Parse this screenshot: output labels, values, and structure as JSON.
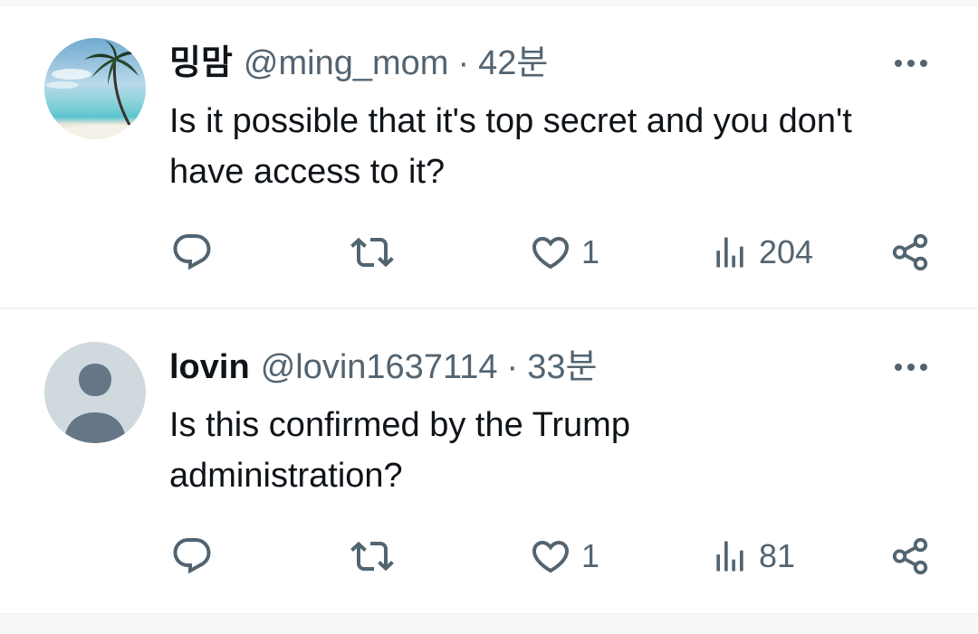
{
  "tweets": [
    {
      "display_name": "밍맘",
      "handle": "@ming_mom",
      "separator": "·",
      "time": "42분",
      "text": "Is it possible that it's top secret and you don't have access to it?",
      "avatar_icon": "palm-beach-avatar",
      "likes": "1",
      "views": "204"
    },
    {
      "display_name": "lovin",
      "handle": "@lovin1637114",
      "separator": "·",
      "time": "33분",
      "text": "Is this confirmed by the Trump administration?",
      "avatar_icon": "default-profile-avatar",
      "likes": "1",
      "views": "81"
    }
  ],
  "colors": {
    "text_primary": "#0f1419",
    "text_secondary": "#536471",
    "divider": "#eff3f4",
    "default_avatar_bg": "#cfd9de"
  },
  "icons": [
    "reply-icon",
    "retweet-icon",
    "heart-icon",
    "views-icon",
    "share-icon",
    "more-icon"
  ]
}
